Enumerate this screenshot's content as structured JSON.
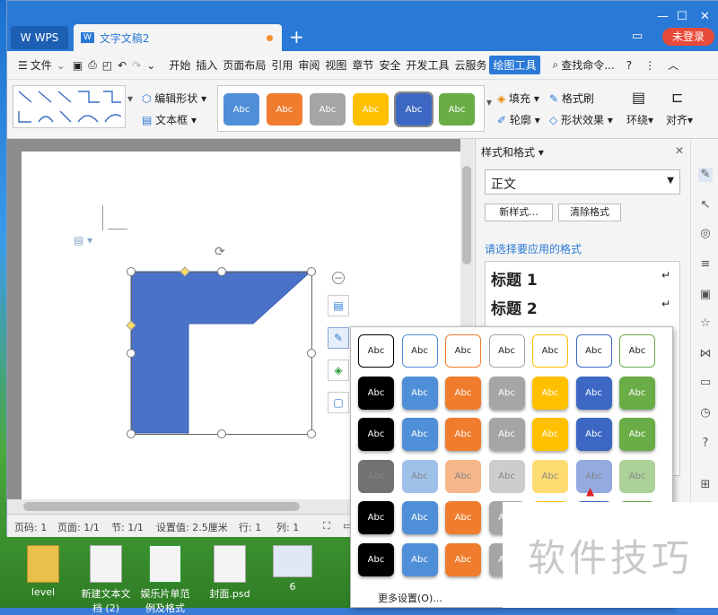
{
  "titlebar": {
    "wps_tab": "WPS",
    "doc_tab": "文字文稿2",
    "new_tab": "+",
    "login": "未登录",
    "min": "—",
    "max": "☐",
    "close": "✕"
  },
  "menu": {
    "file": "文件",
    "items": [
      "开始",
      "插入",
      "页面布局",
      "引用",
      "审阅",
      "视图",
      "章节",
      "安全",
      "开发工具",
      "云服务",
      "绘图工具"
    ],
    "search": "查找命令...",
    "help": "?",
    "more": "⋮",
    "collapse": "︿"
  },
  "toolbar": {
    "edit_shape": "编辑形状",
    "text_box": "文本框",
    "fill": "填充",
    "format_painter": "格式刷",
    "outline": "轮廓",
    "shape_effect": "形状效果",
    "wrap": "环绕",
    "align": "对齐",
    "style_abc": "Abc"
  },
  "panel": {
    "title": "样式和格式",
    "style_value": "正文",
    "new_style": "新样式...",
    "clear_format": "清除格式",
    "choose_label": "请选择要应用的格式",
    "heading1": "标题 1",
    "heading2": "标题 2"
  },
  "popup": {
    "more_settings": "更多设置(O)...",
    "abc": "Abc"
  },
  "statusbar": {
    "page_num": "页码: 1",
    "pages": "页面: 1/1",
    "section": "节: 1/1",
    "setting": "设置值: 2.5厘米",
    "row": "行: 1",
    "col": "列: 1"
  },
  "desktop": {
    "icons": [
      "level",
      "新建文本文档 (2)",
      "娱乐片单范例及格式",
      "封面.psd",
      "6"
    ]
  },
  "watermark": "软件技巧",
  "colors": {
    "titlebar": "#2b79d6",
    "accent": "#2b79d6",
    "shape": "#4a72c8",
    "login": "#e84a3a"
  }
}
